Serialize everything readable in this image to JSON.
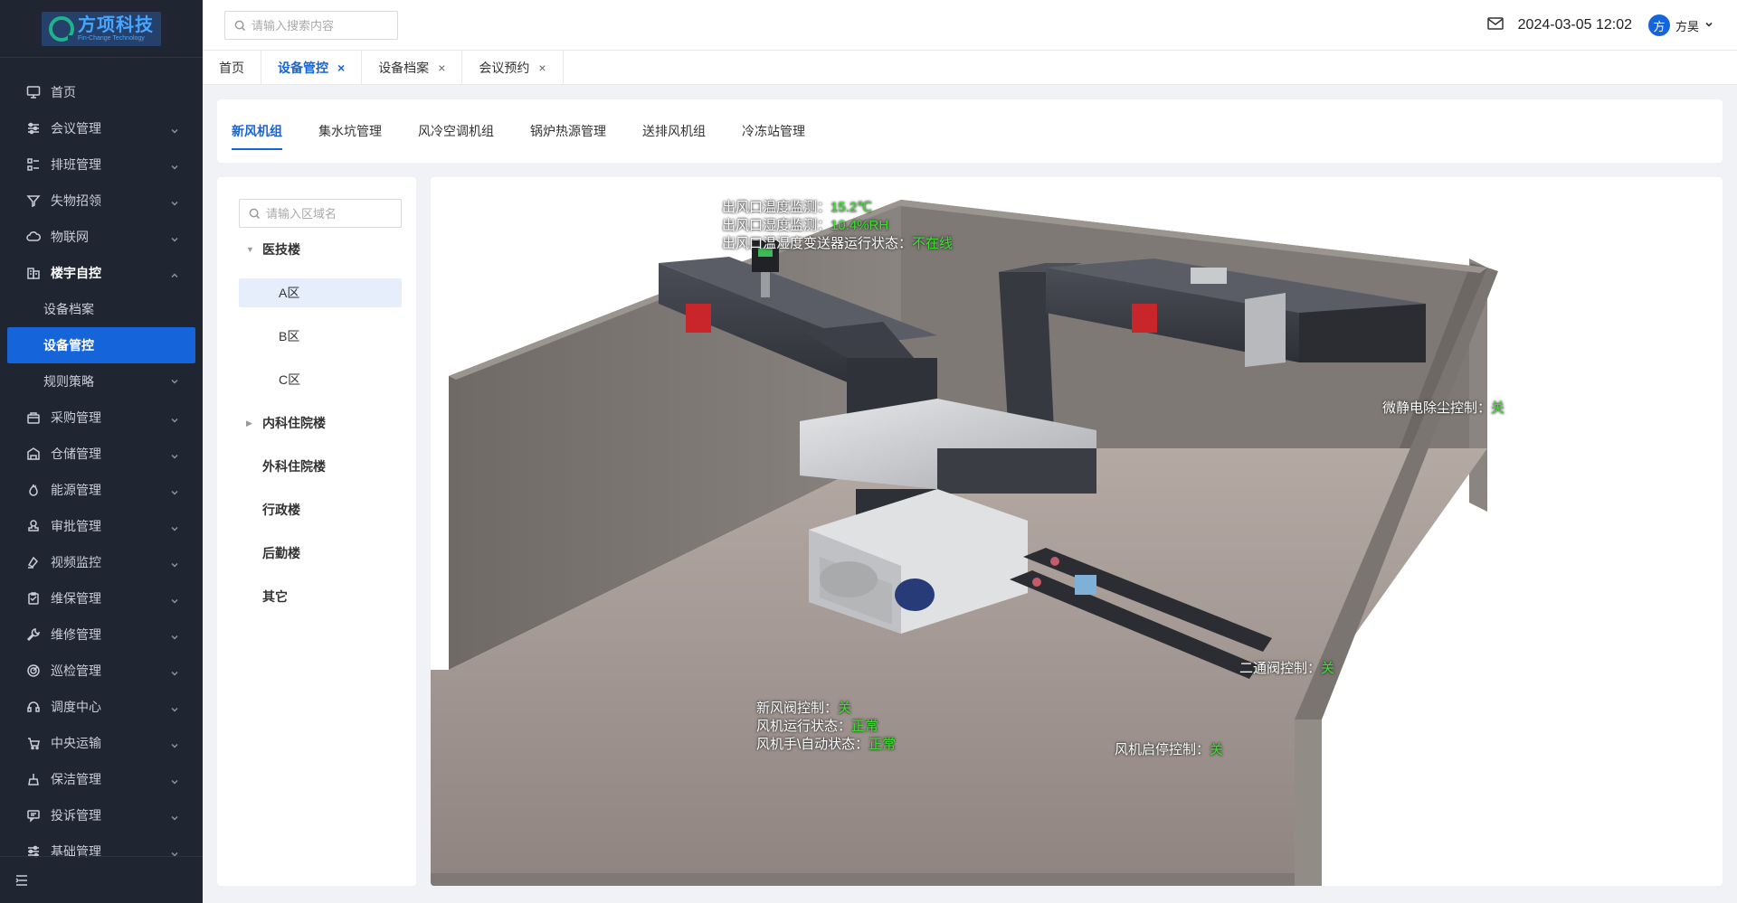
{
  "brand": {
    "name": "方项科技",
    "subtitle": "Fin-Change Technology"
  },
  "sidebar": {
    "items": [
      {
        "label": "首页",
        "icon": "monitor-icon",
        "expandable": false
      },
      {
        "label": "会议管理",
        "icon": "sliders-icon",
        "expandable": true
      },
      {
        "label": "排班管理",
        "icon": "list-icon",
        "expandable": true
      },
      {
        "label": "失物招领",
        "icon": "funnel-icon",
        "expandable": true
      },
      {
        "label": "物联网",
        "icon": "cloud-icon",
        "expandable": true
      },
      {
        "label": "楼宇自控",
        "icon": "building-icon",
        "expandable": true,
        "open": true,
        "children": [
          {
            "label": "设备档案"
          },
          {
            "label": "设备管控",
            "active": true
          },
          {
            "label": "规则策略",
            "expandable": true
          }
        ]
      },
      {
        "label": "采购管理",
        "icon": "bag-icon",
        "expandable": true
      },
      {
        "label": "仓储管理",
        "icon": "warehouse-icon",
        "expandable": true
      },
      {
        "label": "能源管理",
        "icon": "flame-icon",
        "expandable": true
      },
      {
        "label": "审批管理",
        "icon": "stamp-icon",
        "expandable": true
      },
      {
        "label": "视频监控",
        "icon": "camera-icon",
        "expandable": true
      },
      {
        "label": "维保管理",
        "icon": "clipboard-icon",
        "expandable": true
      },
      {
        "label": "维修管理",
        "icon": "wrench-icon",
        "expandable": true
      },
      {
        "label": "巡检管理",
        "icon": "radar-icon",
        "expandable": true
      },
      {
        "label": "调度中心",
        "icon": "headset-icon",
        "expandable": true
      },
      {
        "label": "中央运输",
        "icon": "cart-icon",
        "expandable": true
      },
      {
        "label": "保洁管理",
        "icon": "broom-icon",
        "expandable": true
      },
      {
        "label": "投诉管理",
        "icon": "chat-icon",
        "expandable": true
      },
      {
        "label": "基础管理",
        "icon": "settings-icon",
        "expandable": true
      }
    ]
  },
  "header": {
    "search_placeholder": "请输入搜索内容",
    "datetime": "2024-03-05 12:02",
    "avatar_text": "方",
    "username": "方昊"
  },
  "page_tabs": [
    {
      "label": "首页",
      "closable": false
    },
    {
      "label": "设备管控",
      "closable": true,
      "active": true
    },
    {
      "label": "设备档案",
      "closable": true
    },
    {
      "label": "会议预约",
      "closable": true
    }
  ],
  "sub_tabs": [
    {
      "label": "新风机组",
      "active": true
    },
    {
      "label": "集水坑管理"
    },
    {
      "label": "风冷空调机组"
    },
    {
      "label": "锅炉热源管理"
    },
    {
      "label": "送排风机组"
    },
    {
      "label": "冷冻站管理"
    }
  ],
  "tree": {
    "search_placeholder": "请输入区域名",
    "nodes": [
      {
        "label": "医技楼",
        "expanded": true,
        "children": [
          {
            "label": "A区",
            "selected": true
          },
          {
            "label": "B区"
          },
          {
            "label": "C区"
          }
        ]
      },
      {
        "label": "内科住院楼",
        "collapsed": true
      },
      {
        "label": "外科住院楼"
      },
      {
        "label": "行政楼"
      },
      {
        "label": "后勤楼"
      },
      {
        "label": "其它"
      }
    ]
  },
  "scene": {
    "labels": {
      "outlet_temp": {
        "key": "出风口温度监测：",
        "value": "15.2℃"
      },
      "outlet_humidity": {
        "key": "出风口湿度监测：",
        "value": "10.4%RH"
      },
      "sensor_status": {
        "key": "出风口温湿度变送器运行状态：",
        "value": "不在线"
      },
      "dust_control": {
        "key": "微静电除尘控制：",
        "value": "关"
      },
      "two_way_valve": {
        "key": "二通阀控制：",
        "value": "关"
      },
      "fresh_air_valve": {
        "key": "新风阀控制：",
        "value": "关"
      },
      "fan_run_status": {
        "key": "风机运行状态：",
        "value": "正常"
      },
      "fan_mode_status": {
        "key": "风机手\\自动状态：",
        "value": "正常"
      },
      "fan_start_stop": {
        "key": "风机启停控制：",
        "value": "关"
      }
    },
    "colors": {
      "value_green": "#3ce12e",
      "accent": "#1664d9"
    }
  }
}
